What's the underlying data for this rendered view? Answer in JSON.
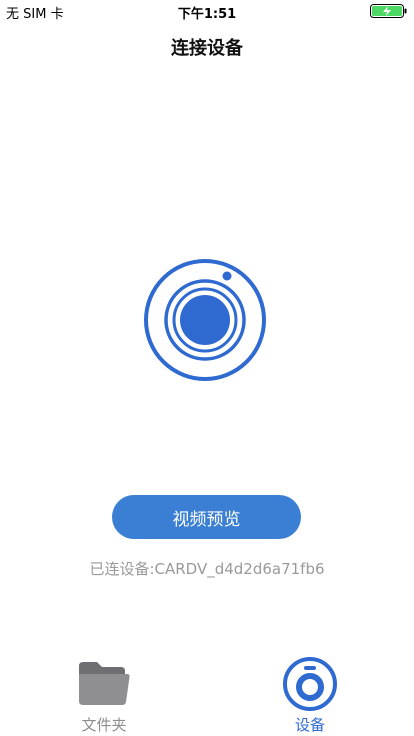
{
  "status_bar": {
    "carrier": "无 SIM 卡",
    "time": "下午1:51",
    "battery_icon": "battery-charging-icon",
    "battery_color": "#4cd964"
  },
  "nav": {
    "title": "连接设备"
  },
  "main": {
    "camera_icon": "camera-lens-icon",
    "preview_button_label": "视频预览",
    "connection_status": "已连设备:CARDV_d4d2d6a71fb6"
  },
  "tab_bar": {
    "tabs": [
      {
        "label": "文件夹",
        "icon": "folder-icon",
        "selected": false
      },
      {
        "label": "设备",
        "icon": "device-camera-icon",
        "selected": true
      }
    ]
  },
  "colors": {
    "accent": "#3b7fd4",
    "icon_blue": "#2f6ad0",
    "inactive_gray": "#8e8e8e",
    "status_text_gray": "#9a9a9a"
  }
}
